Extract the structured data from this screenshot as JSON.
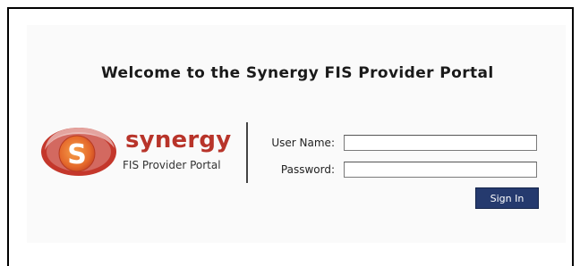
{
  "header": {
    "welcome_text": "Welcome to the Synergy FIS Provider Portal"
  },
  "brand": {
    "logo_letter": "S",
    "name": "synergy",
    "subtitle": "FIS Provider Portal",
    "colors": {
      "logo_outer": "#c4372b",
      "logo_inner": "#e8763a",
      "name": "#b8342a"
    }
  },
  "login": {
    "username_label": "User Name:",
    "username_value": "",
    "password_label": "Password:",
    "password_value": "",
    "signin_label": "Sign In",
    "signin_color": "#253a6e"
  }
}
